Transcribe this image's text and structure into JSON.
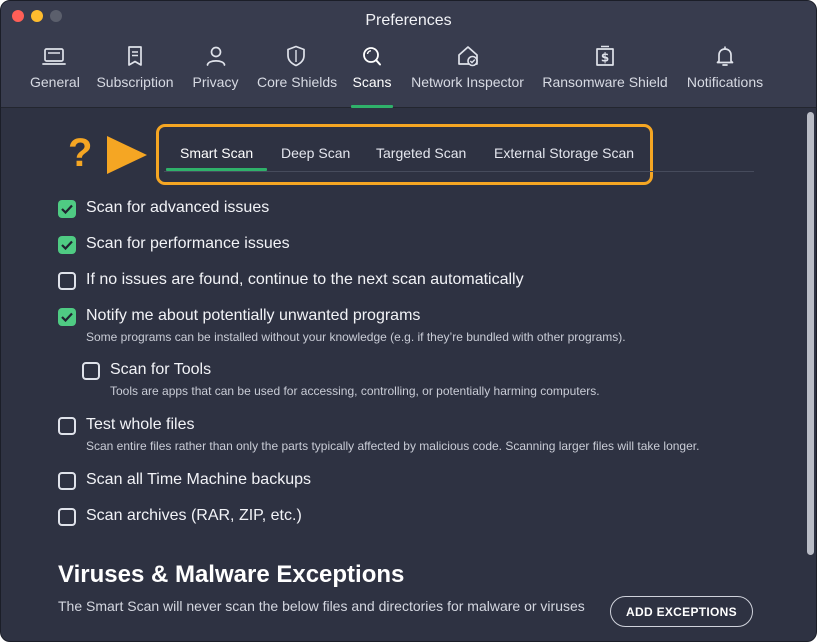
{
  "window": {
    "title": "Preferences"
  },
  "toolbar": {
    "items": [
      {
        "label": "General",
        "icon": "laptop-icon"
      },
      {
        "label": "Subscription",
        "icon": "document-icon"
      },
      {
        "label": "Privacy",
        "icon": "person-icon"
      },
      {
        "label": "Core Shields",
        "icon": "shield-icon"
      },
      {
        "label": "Scans",
        "icon": "scan-icon",
        "active": true
      },
      {
        "label": "Network Inspector",
        "icon": "home-network-icon"
      },
      {
        "label": "Ransomware Shield",
        "icon": "ransomware-icon"
      },
      {
        "label": "Notifications",
        "icon": "bell-icon"
      }
    ]
  },
  "annotation": {
    "question_mark": "?"
  },
  "scan_tabs": {
    "items": [
      {
        "label": "Smart Scan",
        "active": true
      },
      {
        "label": "Deep Scan"
      },
      {
        "label": "Targeted Scan"
      },
      {
        "label": "External Storage Scan"
      }
    ]
  },
  "options": [
    {
      "label": "Scan for advanced issues",
      "checked": true
    },
    {
      "label": "Scan for performance issues",
      "checked": true
    },
    {
      "label": "If no issues are found, continue to the next scan automatically",
      "checked": false
    },
    {
      "label": "Notify me about potentially unwanted programs",
      "checked": true,
      "description": "Some programs can be installed without your knowledge (e.g. if they’re bundled with other programs)."
    },
    {
      "label": "Scan for Tools",
      "checked": false,
      "description": "Tools are apps that can be used for accessing, controlling, or potentially harming computers."
    },
    {
      "label": "Test whole files",
      "checked": false,
      "description": "Scan entire files rather than only the parts typically affected by malicious code. Scanning larger files will take longer."
    },
    {
      "label": "Scan all Time Machine backups",
      "checked": false
    },
    {
      "label": "Scan archives (RAR, ZIP, etc.)",
      "checked": false
    }
  ],
  "exceptions": {
    "title": "Viruses & Malware Exceptions",
    "description": "The Smart Scan will never scan the below files and directories for malware or viruses",
    "button_label": "ADD EXCEPTIONS"
  },
  "colors": {
    "accent": "#2fb16a",
    "checkbox": "#4fcb83",
    "highlight": "#f5a623",
    "background": "#2e3242"
  }
}
